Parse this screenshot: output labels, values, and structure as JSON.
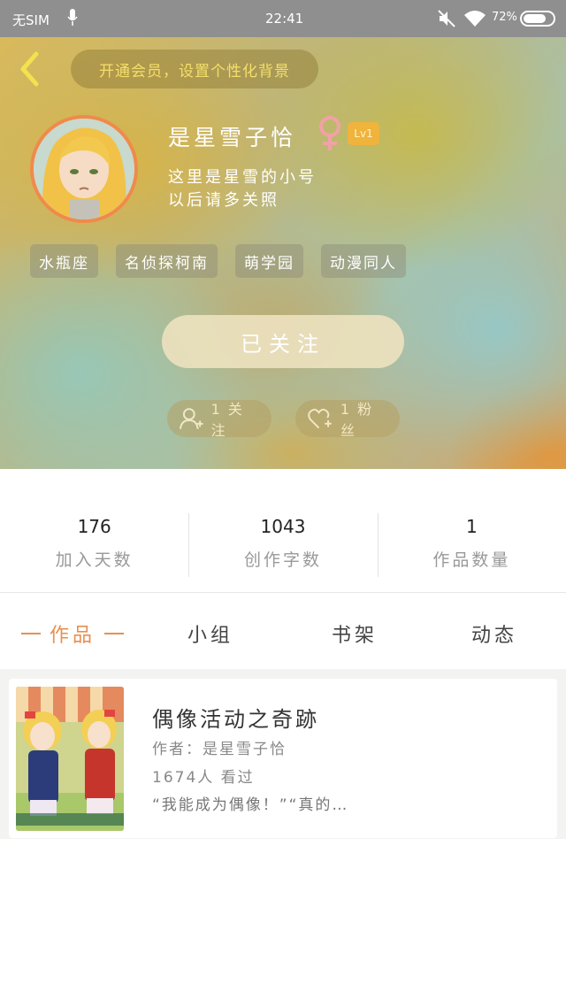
{
  "status_bar": {
    "sim": "无SIM",
    "time": "22:41",
    "battery": "72%"
  },
  "header": {
    "vip_prompt": "开通会员，设置个性化背景",
    "username": "是星雪子恰",
    "level": "Lv1",
    "bio_line1": "这里是星雪的小号",
    "bio_line2": "以后请多关照",
    "tags": [
      "水瓶座",
      "名侦探柯南",
      "萌学园",
      "动漫同人"
    ],
    "follow_button": "已关注",
    "following": "1 关注",
    "fans": "1 粉丝"
  },
  "stats": [
    {
      "value": "176",
      "label": "加入天数"
    },
    {
      "value": "1043",
      "label": "创作字数"
    },
    {
      "value": "1",
      "label": "作品数量"
    }
  ],
  "tabs": {
    "works": "作品",
    "groups": "小组",
    "bookshelf": "书架",
    "moments": "动态"
  },
  "work": {
    "title": "偶像活动之奇跡",
    "author": "作者：是星雪子恰",
    "views": "1674人 看过",
    "excerpt": "“我能成为偶像！”“真的…"
  },
  "colors": {
    "accent": "#e7904f",
    "level_badge": "#f0b33c",
    "avatar_border": "#f08a4b"
  }
}
